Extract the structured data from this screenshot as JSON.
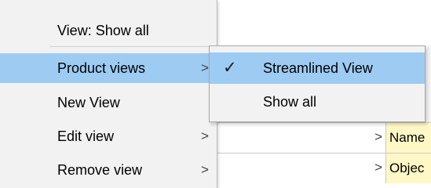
{
  "menu": {
    "items": [
      {
        "label": "View: Show all",
        "chevron": ""
      },
      {
        "label": "Product views",
        "chevron": ">"
      },
      {
        "label": "New View",
        "chevron": ""
      },
      {
        "label": "Edit view",
        "chevron": ">"
      },
      {
        "label": "Remove view",
        "chevron": ">"
      }
    ]
  },
  "submenu": {
    "check_glyph": "✓",
    "items": [
      {
        "label": "Streamlined View"
      },
      {
        "label": "Show all"
      }
    ]
  },
  "grid": {
    "rows": [
      {
        "chevron": ">",
        "label": "Name"
      },
      {
        "chevron": ">",
        "label": "Objec"
      }
    ]
  },
  "colors": {
    "menu_background": "#f2f2f2",
    "highlight": "#9dcbf2",
    "grid_label_background": "#fff8c6"
  }
}
